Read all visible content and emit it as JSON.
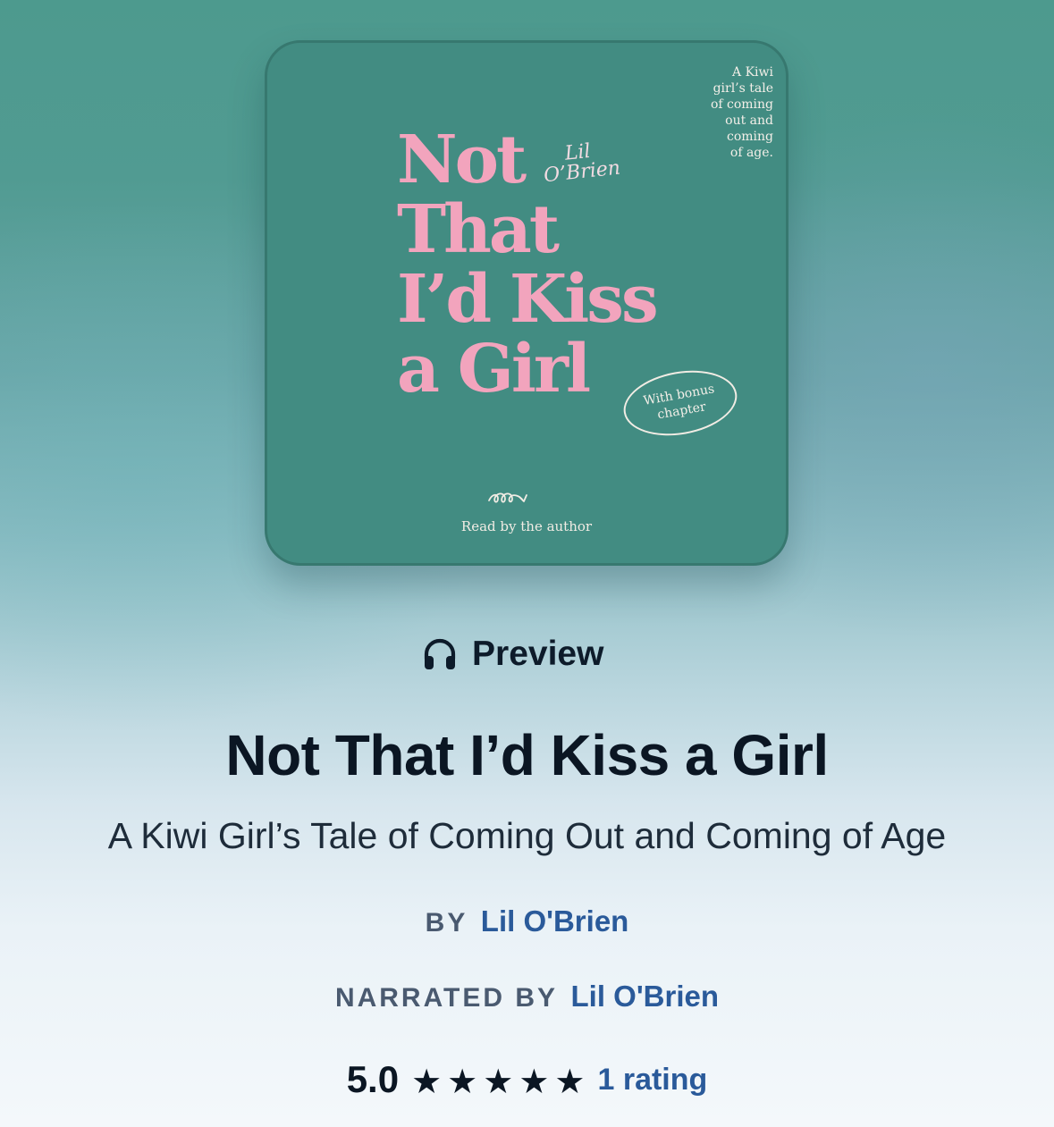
{
  "cover": {
    "title_lines": [
      "Not",
      "That",
      "I’d Kiss",
      "a Girl"
    ],
    "author_lines": [
      "Lil",
      "O’Brien"
    ],
    "tagline_lines": [
      "A Kiwi",
      "girl’s tale",
      "of coming",
      "out and",
      "coming",
      "of age."
    ],
    "bonus_lines": [
      "With bonus",
      "chapter"
    ],
    "read_by": "Read by the author",
    "colors": {
      "background": "#428c82",
      "title_pink": "#f2a4bd"
    }
  },
  "preview": {
    "label": "Preview",
    "icon": "headphones-icon"
  },
  "book": {
    "title": "Not That I’d Kiss a Girl",
    "subtitle": "A Kiwi Girl’s Tale of Coming Out and Coming of Age"
  },
  "credits": {
    "author_prefix": "BY",
    "author": "Lil O'Brien",
    "narrator_prefix": "NARRATED BY",
    "narrator": "Lil O'Brien"
  },
  "rating": {
    "score": "5.0",
    "stars_filled": 5,
    "stars_total": 5,
    "count_label": "1 rating"
  },
  "colors": {
    "link": "#2a5a9a",
    "text_dark": "#0b1623",
    "label_muted": "#4a5a70"
  }
}
